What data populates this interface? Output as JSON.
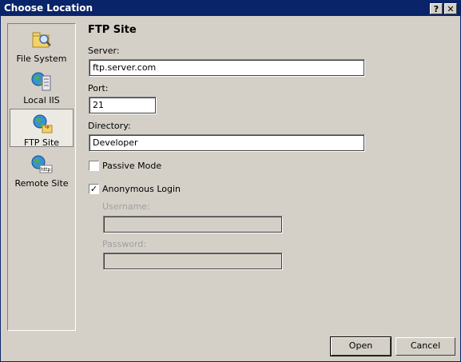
{
  "window": {
    "title": "Choose Location",
    "help_glyph": "?",
    "close_glyph": "✕"
  },
  "sidebar": {
    "items": [
      {
        "label": "File System",
        "icon": "folder-search-icon",
        "selected": false
      },
      {
        "label": "Local IIS",
        "icon": "globe-server-icon",
        "selected": false
      },
      {
        "label": "FTP Site",
        "icon": "globe-folder-icon",
        "selected": true
      },
      {
        "label": "Remote Site",
        "icon": "globe-http-icon",
        "selected": false
      }
    ]
  },
  "form": {
    "heading": "FTP Site",
    "server_label": "Server:",
    "server_value": "ftp.server.com",
    "port_label": "Port:",
    "port_value": "21",
    "directory_label": "Directory:",
    "directory_value": "Developer",
    "passive_mode_label": "Passive Mode",
    "passive_mode_checked": false,
    "anonymous_login_label": "Anonymous Login",
    "anonymous_login_checked": true,
    "username_label": "Username:",
    "username_value": "",
    "password_label": "Password:",
    "password_value": ""
  },
  "buttons": {
    "open": "Open",
    "cancel": "Cancel"
  }
}
